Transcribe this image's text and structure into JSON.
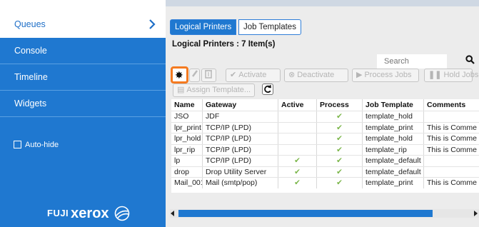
{
  "sidebar": {
    "items": [
      {
        "label": "Queues",
        "active": true
      },
      {
        "label": "Console"
      },
      {
        "label": "Timeline"
      },
      {
        "label": "Widgets"
      }
    ],
    "autohide_label": "Auto-hide",
    "logo": {
      "fuji": "FUJI",
      "xerox": "xerox"
    }
  },
  "main": {
    "tabs": [
      {
        "label": "Logical Printers",
        "active": true
      },
      {
        "label": "Job Templates"
      }
    ],
    "list_title": "Logical Printers : 7 Item(s)",
    "search_placeholder": "Search",
    "toolbar": {
      "activate": "Activate",
      "deactivate": "Deactivate",
      "process_jobs": "Process Jobs",
      "hold_jobs": "Hold Jobs",
      "assign_template": "Assign Template..."
    },
    "table": {
      "columns": [
        "Name",
        "Gateway",
        "Active",
        "Process",
        "Job Template",
        "Comments"
      ],
      "rows": [
        {
          "name": "JSO",
          "gateway": "JDF",
          "active": false,
          "process": true,
          "template": "template_hold",
          "comments": ""
        },
        {
          "name": "lpr_print",
          "gateway": "TCP/IP (LPD)",
          "active": false,
          "process": true,
          "template": "template_print",
          "comments": "This is Comme"
        },
        {
          "name": "lpr_hold",
          "gateway": "TCP/IP (LPD)",
          "active": false,
          "process": true,
          "template": "template_hold",
          "comments": "This is Comme"
        },
        {
          "name": "lpr_rip",
          "gateway": "TCP/IP (LPD)",
          "active": false,
          "process": true,
          "template": "template_rip",
          "comments": "This is Comme"
        },
        {
          "name": "lp",
          "gateway": "TCP/IP (LPD)",
          "active": true,
          "process": true,
          "template": "template_default",
          "comments": ""
        },
        {
          "name": "drop",
          "gateway": "Drop Utility Server",
          "active": true,
          "process": true,
          "template": "template_default",
          "comments": ""
        },
        {
          "name": "Mail_001",
          "gateway": "Mail (smtp/pop)",
          "active": true,
          "process": true,
          "template": "template_print",
          "comments": "This is Comme"
        }
      ]
    }
  },
  "colors": {
    "sidebar_blue": "#1f78d0",
    "highlight_orange": "#f47a20",
    "check_green": "#7bb64a"
  }
}
